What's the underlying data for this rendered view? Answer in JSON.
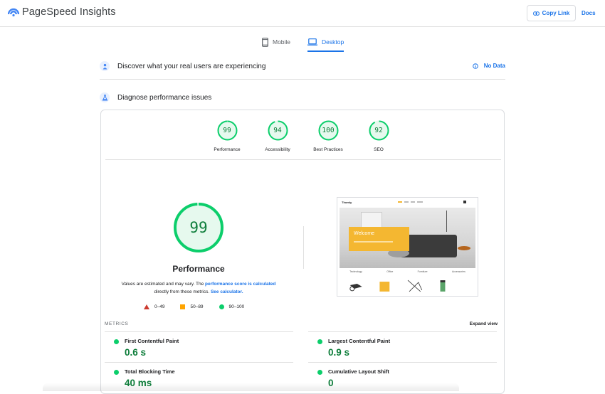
{
  "app": {
    "title": "PageSpeed Insights"
  },
  "header": {
    "copy_link_label": "Copy Link",
    "docs_label": "Docs"
  },
  "tabs": [
    {
      "label": "Mobile",
      "active": false,
      "icon": "phone-icon"
    },
    {
      "label": "Desktop",
      "active": true,
      "icon": "laptop-icon"
    }
  ],
  "field_data": {
    "title": "Discover what your real users are experiencing",
    "status": "No Data"
  },
  "diagnose": {
    "title": "Diagnose performance issues"
  },
  "category_scores": [
    {
      "label": "Performance",
      "score": "99",
      "value": 99
    },
    {
      "label": "Accessibility",
      "score": "94",
      "value": 94
    },
    {
      "label": "Best Practices",
      "score": "100",
      "value": 100
    },
    {
      "label": "SEO",
      "score": "92",
      "value": 92
    }
  ],
  "performance": {
    "score": "99",
    "value": 99,
    "title": "Performance",
    "note_prefix": "Values are estimated and may vary. The",
    "note_link1": "performance score is calculated",
    "note_middle": "directly from these metrics.",
    "note_link2": "See calculator."
  },
  "legend": [
    {
      "label": "0–49",
      "shape": "triangle",
      "color": "#ff4e42"
    },
    {
      "label": "50–89",
      "shape": "square",
      "color": "#ffa400"
    },
    {
      "label": "90–100",
      "shape": "circle",
      "color": "#0cce6b"
    }
  ],
  "thumbnail": {
    "brand": "Thomly",
    "welcome": "Welcome",
    "categories": [
      "Technology",
      "Office",
      "Furniture",
      "Accessories"
    ]
  },
  "metrics": {
    "label": "METRICS",
    "expand_label": "Expand view",
    "items": [
      {
        "name": "First Contentful Paint",
        "value": "0.6 s"
      },
      {
        "name": "Largest Contentful Paint",
        "value": "0.9 s"
      },
      {
        "name": "Total Blocking Time",
        "value": "40 ms"
      },
      {
        "name": "Cumulative Layout Shift",
        "value": "0"
      }
    ]
  },
  "colors": {
    "accent": "#1a73e8",
    "pass": "#0cce6b",
    "pass_text": "#0d7d3a"
  }
}
